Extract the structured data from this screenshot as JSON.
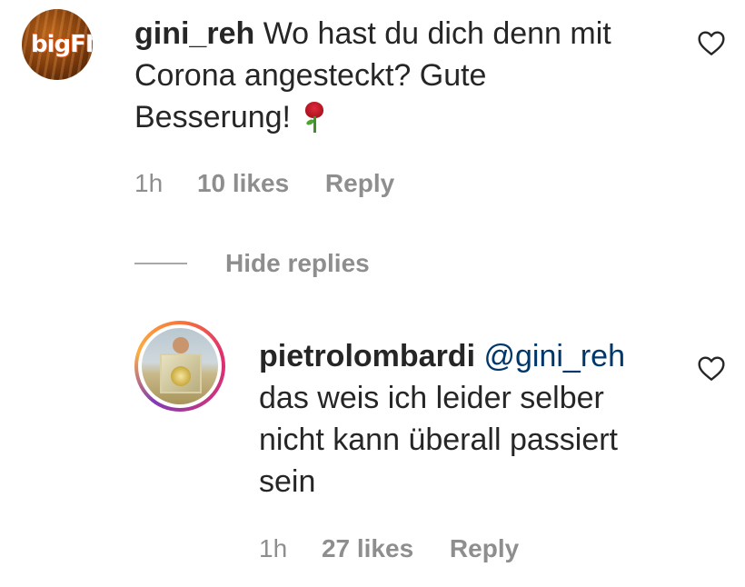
{
  "comment": {
    "username": "gini_reh",
    "text_line1": "Wo hast du dich denn mit",
    "text_line2": "Corona angesteckt? Gute",
    "text_line3": "Besserung!",
    "avatar_logo": "bigFM",
    "emoji": "rose",
    "time": "1h",
    "likes": "10 likes",
    "reply_label": "Reply",
    "like_icon": "heart-outline-icon"
  },
  "replies_toggle": {
    "label": "Hide replies"
  },
  "reply": {
    "username": "pietrolombardi",
    "mention": "@gini_reh",
    "text_line1": "das weis ich leider selber",
    "text_line2": "nicht kann überall passiert",
    "text_line3": "sein",
    "time": "1h",
    "likes": "27 likes",
    "reply_label": "Reply",
    "like_icon": "heart-outline-icon",
    "avatar_ring_colors": [
      "#f77737",
      "#e1306c",
      "#c13584",
      "#833ab4",
      "#fcaf45"
    ]
  },
  "colors": {
    "text": "#262626",
    "secondary": "#8e8e8e",
    "mention": "#00376b"
  }
}
